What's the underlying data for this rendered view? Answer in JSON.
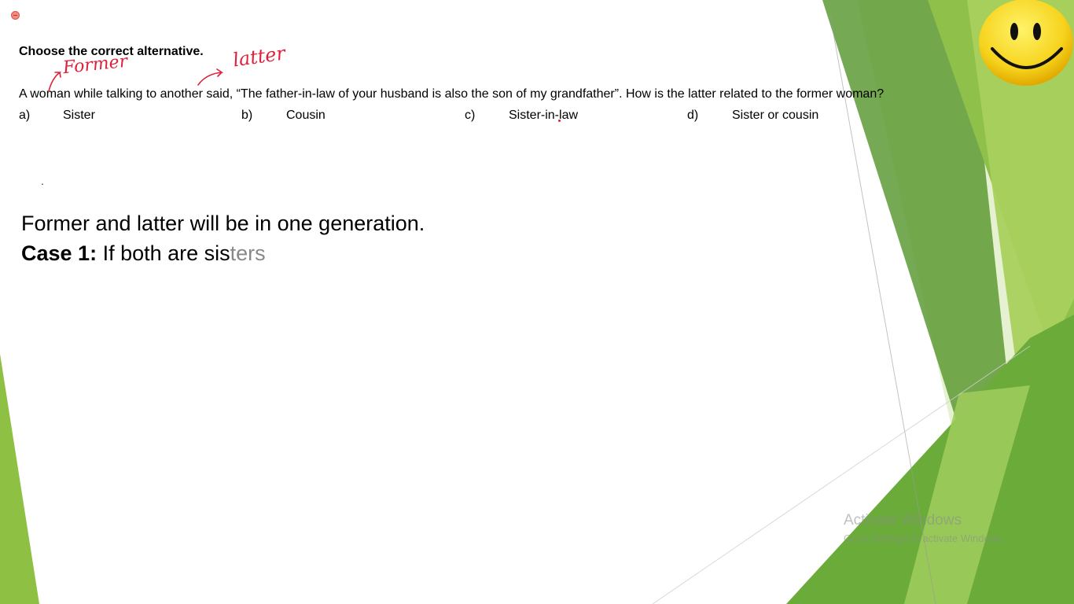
{
  "slide": {
    "instruction": "Choose the correct alternative.",
    "question": "A woman while talking to another said, “The father-in-law of your husband is also the son of my grandfather”. How is the latter related to the former woman?",
    "options": [
      {
        "letter": "a)",
        "text": "Sister"
      },
      {
        "letter": "b)",
        "text": "Cousin"
      },
      {
        "letter": "c)",
        "text": "Sister-in-law"
      },
      {
        "letter": "d)",
        "text": "Sister or cousin"
      }
    ],
    "stray_dot": ".",
    "note": "Former and latter will be in one generation.",
    "case": {
      "label": "Case 1:",
      "text_main": " If both are sis",
      "text_faded": "ters"
    }
  },
  "annotations": {
    "former": "Former",
    "latter": "latter",
    "color": "#e0203a"
  },
  "icons": {
    "recording": "record-dot-icon",
    "smiley": "smiley-face-icon"
  },
  "theme": {
    "green_dark": "#4e8c2a",
    "green_mid": "#7ab648",
    "green_light": "#a6cc5a",
    "green_pale": "#dcebc1"
  },
  "watermark": {
    "line1": "Activate Windows",
    "line2": "Go to Settings to activate Windows."
  }
}
